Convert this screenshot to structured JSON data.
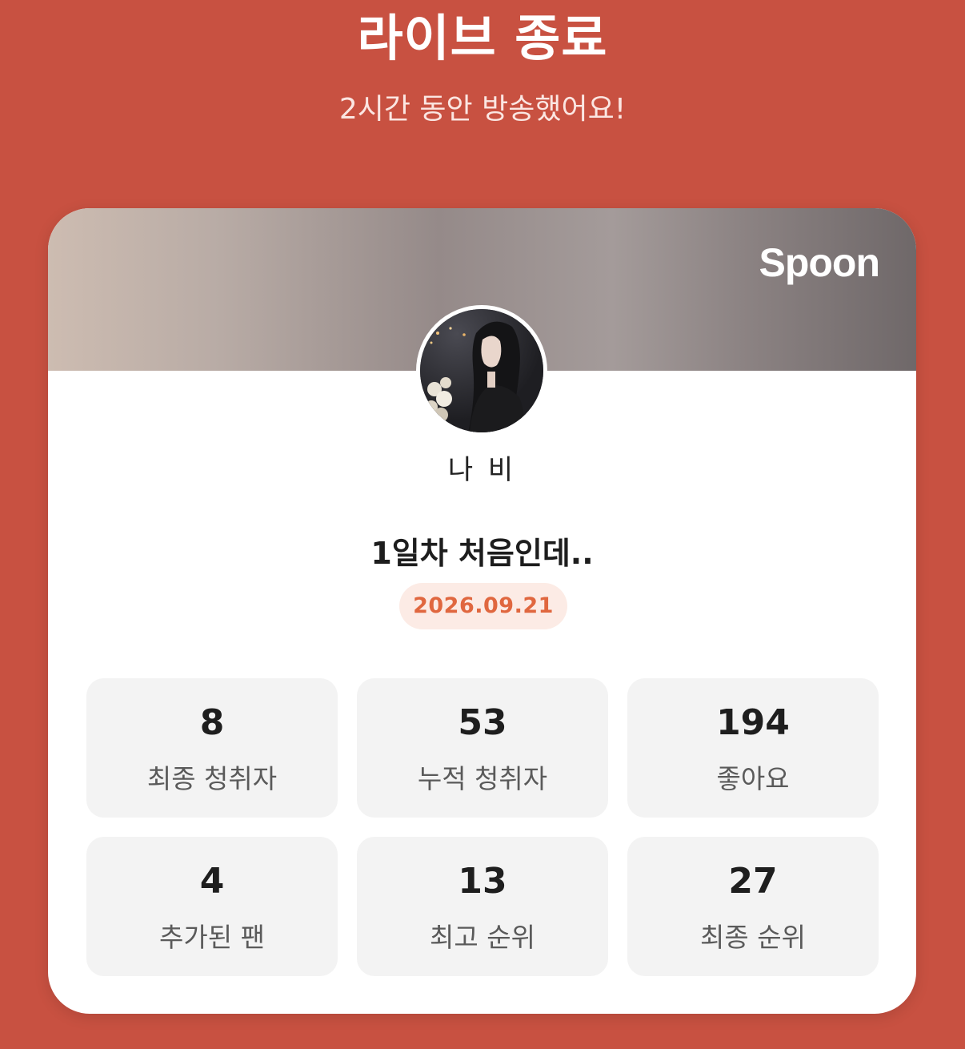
{
  "header": {
    "title": "라이브 종료",
    "subtitle": "2시간 동안 방송했어요!"
  },
  "card": {
    "brand": "Spoon",
    "nickname": "나 비",
    "live_title": "1일차 처음인데..",
    "date": "2026.09.21",
    "stats": [
      {
        "value": "8",
        "label": "최종 청취자"
      },
      {
        "value": "53",
        "label": "누적 청취자"
      },
      {
        "value": "194",
        "label": "좋아요"
      },
      {
        "value": "4",
        "label": "추가된 팬"
      },
      {
        "value": "13",
        "label": "최고 순위"
      },
      {
        "value": "27",
        "label": "최종 순위"
      }
    ]
  },
  "colors": {
    "background": "#c85141",
    "date_badge_text": "#e0673f",
    "date_badge_bg": "#fcebe5",
    "tile_bg": "#f3f3f3"
  }
}
